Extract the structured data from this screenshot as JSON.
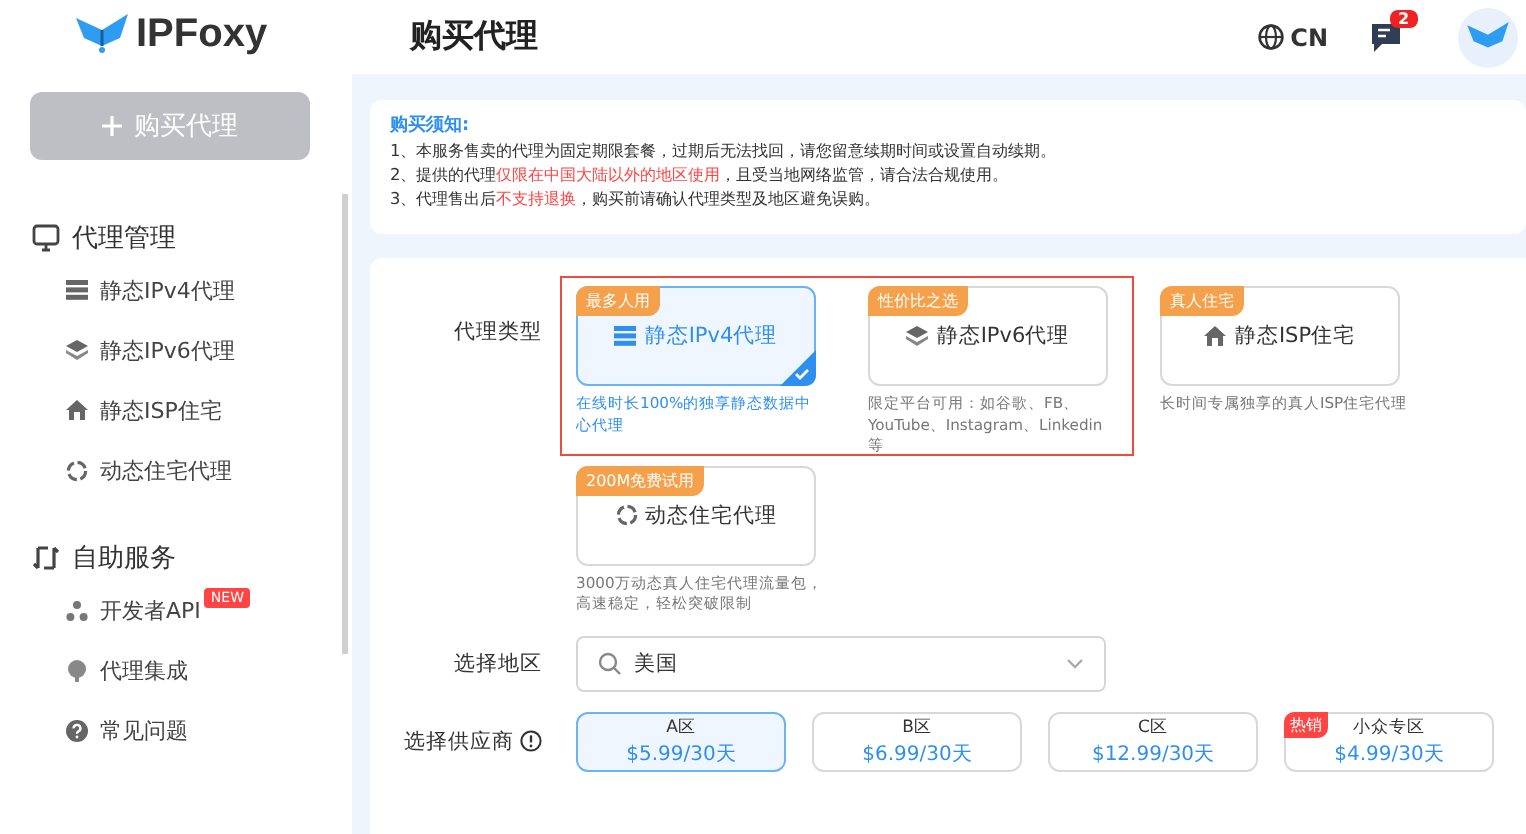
{
  "logo": {
    "text": "IPFoxy"
  },
  "sidebar": {
    "buy_button": "购买代理",
    "sections": [
      {
        "title": "代理管理",
        "items": [
          {
            "label": "静态IPv4代理"
          },
          {
            "label": "静态IPv6代理"
          },
          {
            "label": "静态ISP住宅"
          },
          {
            "label": "动态住宅代理"
          }
        ]
      },
      {
        "title": "自助服务",
        "items": [
          {
            "label": "开发者API",
            "badge": "NEW"
          },
          {
            "label": "代理集成"
          },
          {
            "label": "常见问题"
          }
        ]
      }
    ]
  },
  "header": {
    "title": "购买代理",
    "language": "CN",
    "notification_count": "2"
  },
  "notice": {
    "title": "购买须知:",
    "lines": [
      [
        {
          "text": "1、本服务售卖的代理为固定期限套餐，过期后无法找回，请您留意续期时间或设置自动续期。",
          "warning": false
        }
      ],
      [
        {
          "text": "2、提供的代理",
          "warning": false
        },
        {
          "text": "仅限在中国大陆以外的地区使用",
          "warning": true
        },
        {
          "text": "，且受当地网络监管，请合法合规使用。",
          "warning": false
        }
      ],
      [
        {
          "text": "3、代理售出后",
          "warning": false
        },
        {
          "text": "不支持退换",
          "warning": true
        },
        {
          "text": "，购买前请确认代理类型及地区避免误购。",
          "warning": false
        }
      ]
    ]
  },
  "form": {
    "type_label": "代理类型",
    "types": [
      {
        "tag": "最多人用",
        "name": "静态IPv4代理",
        "description": "在线时长100%的独享静态数据中心代理",
        "selected": true
      },
      {
        "tag": "性价比之选",
        "name": "静态IPv6代理",
        "description": "限定平台可用：如谷歌、FB、YouTube、Instagram、Linkedin等",
        "selected": false
      },
      {
        "tag": "真人住宅",
        "name": "静态ISP住宅",
        "description": "长时间专属独享的真人ISP住宅代理",
        "selected": false
      },
      {
        "tag": "200M免费试用",
        "name": "动态住宅代理",
        "description": "3000万动态真人住宅代理流量包，高速稳定，轻松突破限制",
        "selected": false
      }
    ],
    "region_label": "选择地区",
    "region": {
      "value": "美国"
    },
    "supplier_label": "选择供应商",
    "suppliers": [
      {
        "name": "A区",
        "price": "$5.99/30天",
        "selected": true
      },
      {
        "name": "B区",
        "price": "$6.99/30天",
        "selected": false
      },
      {
        "name": "C区",
        "price": "$12.99/30天",
        "selected": false
      },
      {
        "name": "小众专区",
        "price": "$4.99/30天",
        "selected": false,
        "tag": "热销"
      }
    ]
  }
}
